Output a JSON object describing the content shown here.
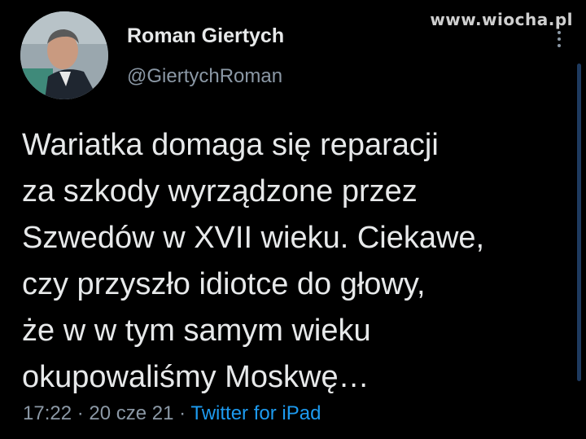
{
  "watermark": "www.wiocha.pl",
  "author": {
    "display_name": "Roman Giertych",
    "handle": "@GiertychRoman"
  },
  "tweet": {
    "lines": [
      "Wariatka domaga się reparacji",
      "za szkody wyrządzone przez",
      "Szwedów w XVII wieku. Ciekawe,",
      "czy przyszło idiotce do głowy,",
      "że w w tym samym wieku",
      "okupowaliśmy Moskwę…"
    ]
  },
  "meta": {
    "time": "17:22",
    "separator": " · ",
    "date": "20 cze 21",
    "source": "Twitter for iPad"
  },
  "colors": {
    "background": "#000000",
    "text": "#e7e9ea",
    "muted": "#8b98a5",
    "link": "#1d9bf0"
  }
}
